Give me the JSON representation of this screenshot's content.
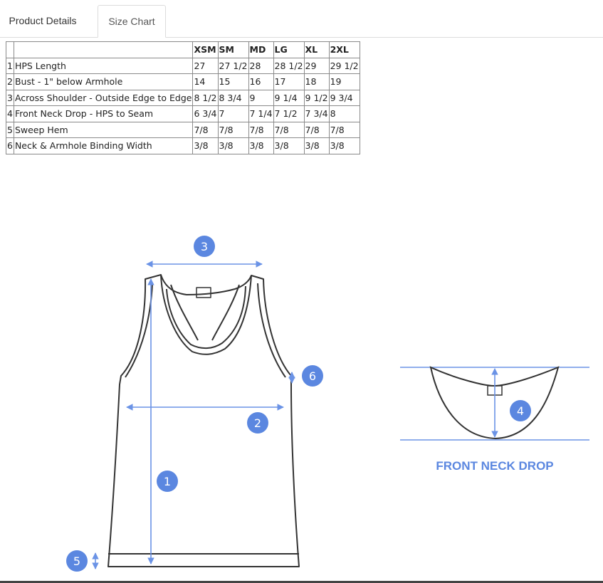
{
  "tabs": [
    {
      "label": "Product Details"
    },
    {
      "label": "Size Chart"
    }
  ],
  "size_table": {
    "headers": [
      "",
      "",
      "XSM",
      "SM",
      "MD",
      "LG",
      "XL",
      "2XL"
    ],
    "rows": [
      [
        "1",
        "HPS Length",
        "27",
        "27 1/2",
        "28",
        "28 1/2",
        "29",
        "29 1/2"
      ],
      [
        "2",
        "Bust - 1\" below Armhole",
        "14",
        "15",
        "16",
        "17",
        "18",
        "19"
      ],
      [
        "3",
        "Across Shoulder - Outside Edge to Edge",
        "8 1/2",
        "8 3/4",
        "9",
        "9 1/4",
        "9 1/2",
        "9 3/4"
      ],
      [
        "4",
        "Front Neck Drop - HPS to Seam",
        "6 3/4",
        "7",
        "7 1/4",
        "7 1/2",
        "7 3/4",
        "8"
      ],
      [
        "5",
        "Sweep Hem",
        "7/8",
        "7/8",
        "7/8",
        "7/8",
        "7/8",
        "7/8"
      ],
      [
        "6",
        "Neck & Armhole Binding Width",
        "3/8",
        "3/8",
        "3/8",
        "3/8",
        "3/8",
        "3/8"
      ]
    ]
  },
  "diagram": {
    "markers": [
      "1",
      "2",
      "3",
      "4",
      "5",
      "6"
    ],
    "neck_caption": "FRONT NECK DROP",
    "accent_color": "#5b87e0",
    "measure_line_color": "#6b93e6",
    "outline_color": "#333333"
  }
}
